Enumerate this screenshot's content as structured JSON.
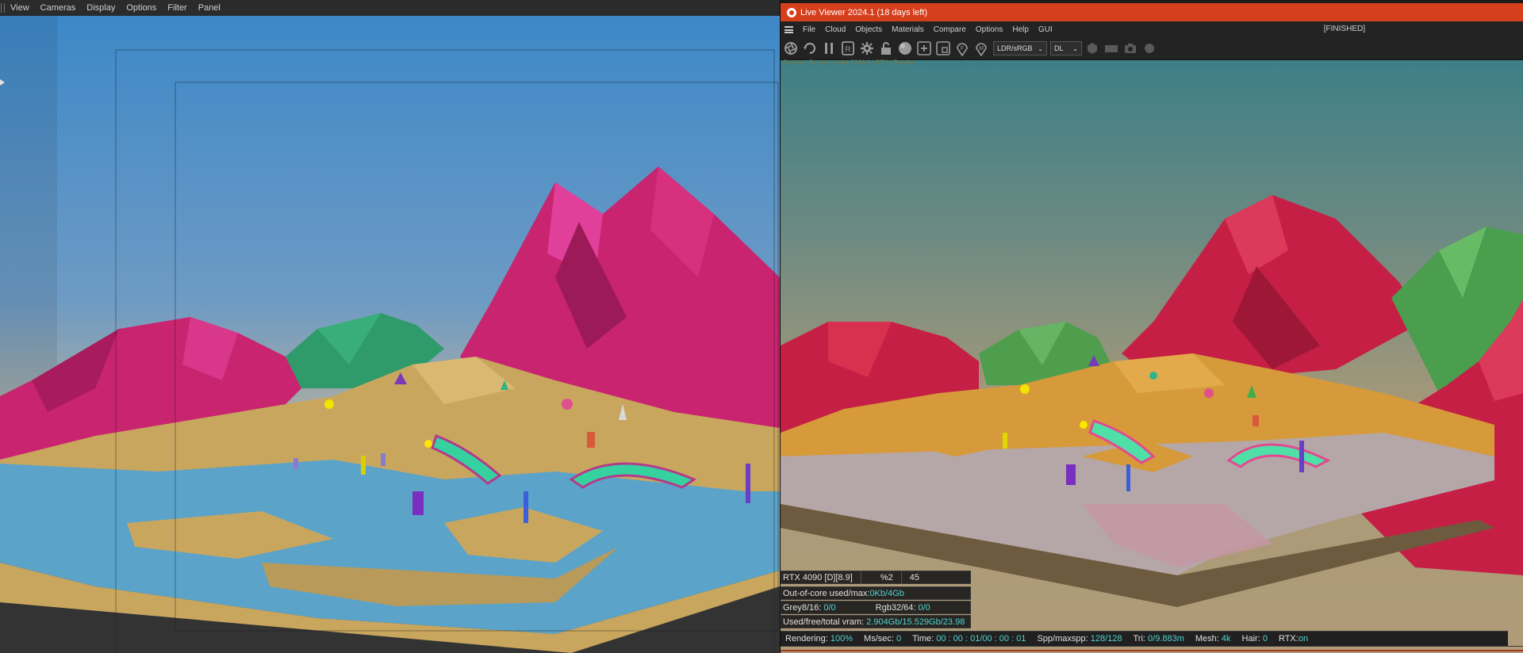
{
  "viewport": {
    "menu": [
      "View",
      "Cameras",
      "Display",
      "Options",
      "Filter",
      "Panel"
    ]
  },
  "live_viewer": {
    "title": "Live Viewer 2024.1 (18 days left)",
    "menu": [
      "File",
      "Cloud",
      "Objects",
      "Materials",
      "Compare",
      "Options",
      "Help",
      "GUI"
    ],
    "status": "[FINISHED]",
    "toolbar_icons": [
      "aperture-icon",
      "refresh-icon",
      "pause-icon",
      "render-region-icon",
      "gear-icon",
      "lock-icon",
      "sphere-icon",
      "add-region-icon",
      "region-icon",
      "focus-pick-icon",
      "material-pick-icon"
    ],
    "colorspace_select": "LDR/sRGB",
    "kernel_select": "DL",
    "stats": {
      "gpu": "RTX 4090 [D][8.9]",
      "gpu_percent": "%2",
      "gpu_temp": "45",
      "out_of_core_label": "Out-of-core used/max:",
      "out_of_core_value": "0Kb/4Gb",
      "grey_label": "Grey8/16:",
      "grey_value": "0/0",
      "rgb_label": "Rgb32/64:",
      "rgb_value": "0/0",
      "vram_label": "Used/free/total vram:",
      "vram_value": "2.904Gb/15.529Gb/23.98"
    },
    "bottom": {
      "rendering_label": "Rendering:",
      "rendering_value": "100%",
      "ms_label": "Ms/sec:",
      "ms_value": "0",
      "time_label": "Time:",
      "time_value": "00 : 00 : 01/00 : 00 : 01",
      "spp_label": "Spp/maxspp:",
      "spp_value": "128/128",
      "tri_label": "Tri:",
      "tri_value": "0/9.883m",
      "mesh_label": "Mesh:",
      "mesh_value": "4k",
      "hair_label": "Hair:",
      "hair_value": "0",
      "rtx_label": "RTX:",
      "rtx_value": "on"
    }
  },
  "colors": {
    "live_viewer_title": "#d63f1c",
    "stat_value": "#4fd3d0",
    "mountain_viewport": "#c8246f",
    "mountain_render": "#c61f45",
    "hills_green": "#2f9a6a",
    "sand_viewport": "#c9a65e",
    "sand_render": "#d69a3a",
    "water_viewport": "#5ba3c9"
  }
}
